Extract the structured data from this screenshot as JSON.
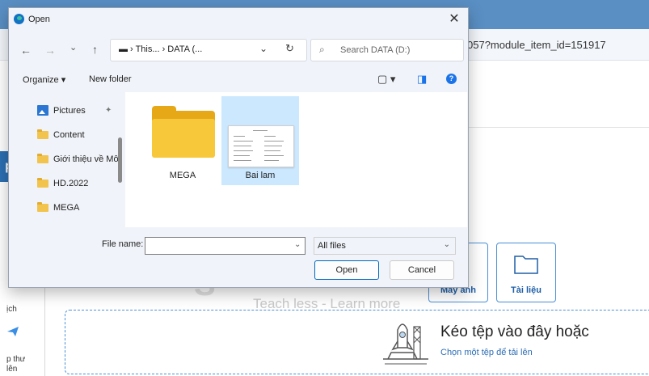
{
  "background": {
    "url_fragment": "057?module_item_id=151917",
    "left_button_text": "p",
    "left_labels": [
      "ịch",
      "p thư",
      "lên"
    ],
    "watermark": "Teach less - Learn more",
    "watermark_letter": "S",
    "tiles": [
      {
        "label": "Máy ảnh"
      },
      {
        "label": "Tài liệu"
      }
    ],
    "dropzone": {
      "title": "Kéo tệp vào đây hoặc",
      "subtitle": "Chọn một tệp để tải lên"
    }
  },
  "dialog": {
    "title": "Open",
    "close": "✕",
    "nav": {
      "back": "←",
      "forward": "→",
      "recent": "⌄",
      "up": "↑"
    },
    "address": {
      "text": "▬  ›  This...  ›  DATA (...",
      "dropdown": "⌄",
      "refresh": "↻"
    },
    "search": {
      "icon": "⌕",
      "placeholder": "Search DATA (D:)"
    },
    "commandbar": {
      "organize": "Organize ▾",
      "new_folder": "New folder",
      "view": "▢ ▾",
      "pane": "◨",
      "help": "?"
    },
    "nav_pane": [
      {
        "label": "Pictures",
        "icon": "pictures-icon",
        "pinned": true
      },
      {
        "label": "Content",
        "icon": "folder-icon"
      },
      {
        "label": "Giới thiệu về Mô",
        "icon": "folder-icon"
      },
      {
        "label": "HD.2022",
        "icon": "folder-icon"
      },
      {
        "label": "MEGA",
        "icon": "folder-icon"
      }
    ],
    "pin_glyph": "✦",
    "files": [
      {
        "name": "MEGA",
        "type": "folder"
      },
      {
        "name": "Bai lam",
        "type": "document",
        "selected": true
      }
    ],
    "file_name_label": "File name:",
    "file_name_value": "",
    "filter": "All files",
    "dropdown_glyph": "⌄",
    "open_label": "Open",
    "cancel_label": "Cancel"
  }
}
